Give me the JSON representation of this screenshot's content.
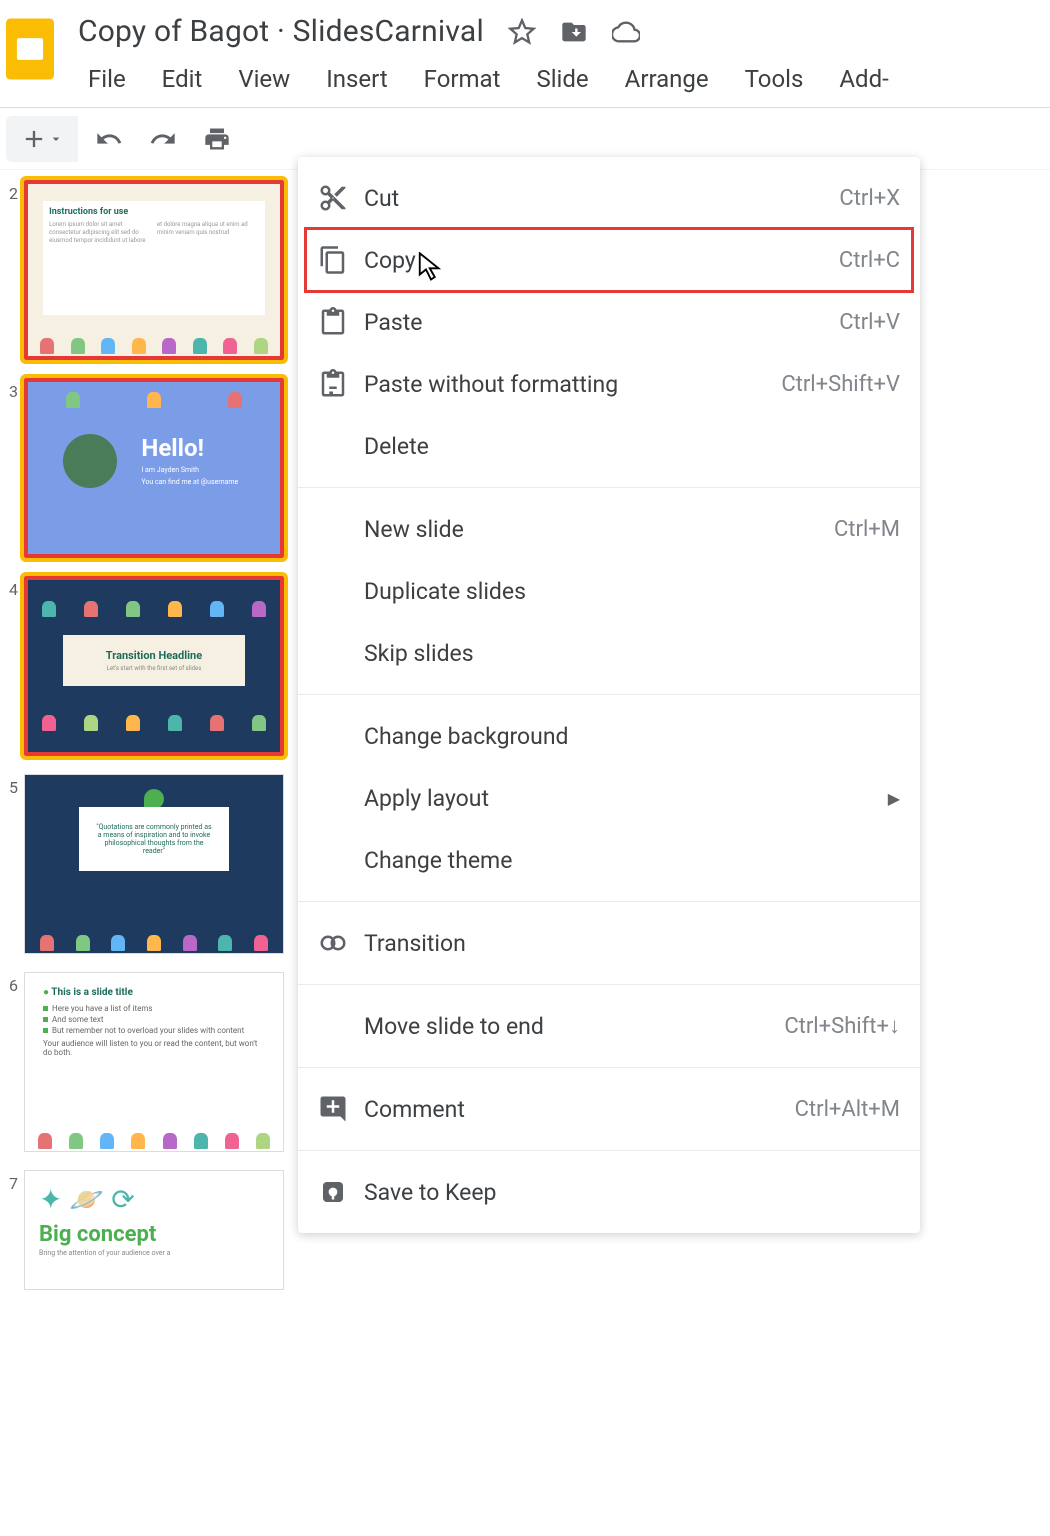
{
  "header": {
    "title": "Copy of Bagot · SlidesCarnival",
    "menus": [
      "File",
      "Edit",
      "View",
      "Insert",
      "Format",
      "Slide",
      "Arrange",
      "Tools",
      "Add-"
    ]
  },
  "thumbnails": [
    {
      "num": "2",
      "title": "Instructions for use",
      "variant": "cream",
      "selected": true,
      "highlighted": true
    },
    {
      "num": "3",
      "title": "Hello!",
      "subtitle": "I am Jayden Smith",
      "line2": "You can find me at @username",
      "variant": "blue",
      "selected": true,
      "highlighted": true
    },
    {
      "num": "4",
      "title": "Transition Headline",
      "subtitle": "Let's start with the first set of slides",
      "variant": "navy",
      "selected": true,
      "highlighted": true
    },
    {
      "num": "5",
      "quote": "\"Quotations are commonly printed as a means of inspiration and to invoke philosophical thoughts from the reader\"",
      "variant": "navy",
      "selected": false,
      "highlighted": false
    },
    {
      "num": "6",
      "title": "This is a slide title",
      "bullets": [
        "Here you have a list of items",
        "And some text",
        "But remember not to overload your slides with content"
      ],
      "footer": "Your audience will listen to you or read the content, but won't do both.",
      "variant": "white",
      "selected": false,
      "highlighted": false
    },
    {
      "num": "7",
      "title": "Big concept",
      "subtitle": "Bring the attention of your audience over a",
      "variant": "white",
      "selected": false,
      "highlighted": false
    }
  ],
  "context_menu": {
    "items": [
      {
        "label": "Cut",
        "shortcut": "Ctrl+X",
        "icon": "cut"
      },
      {
        "label": "Copy",
        "shortcut": "Ctrl+C",
        "icon": "copy",
        "highlighted": true
      },
      {
        "label": "Paste",
        "shortcut": "Ctrl+V",
        "icon": "paste"
      },
      {
        "label": "Paste without formatting",
        "shortcut": "Ctrl+Shift+V",
        "icon": "paste-plain"
      },
      {
        "label": "Delete",
        "shortcut": "",
        "icon": ""
      },
      {
        "sep": true
      },
      {
        "label": "New slide",
        "shortcut": "Ctrl+M",
        "icon": ""
      },
      {
        "label": "Duplicate slides",
        "shortcut": "",
        "icon": ""
      },
      {
        "label": "Skip slides",
        "shortcut": "",
        "icon": ""
      },
      {
        "sep": true
      },
      {
        "label": "Change background",
        "shortcut": "",
        "icon": ""
      },
      {
        "label": "Apply layout",
        "shortcut": "",
        "icon": "",
        "arrow": true
      },
      {
        "label": "Change theme",
        "shortcut": "",
        "icon": ""
      },
      {
        "sep": true
      },
      {
        "label": "Transition",
        "shortcut": "",
        "icon": "transition"
      },
      {
        "sep": true
      },
      {
        "label": "Move slide to end",
        "shortcut": "Ctrl+Shift+↓",
        "icon": ""
      },
      {
        "sep": true
      },
      {
        "label": "Comment",
        "shortcut": "Ctrl+Alt+M",
        "icon": "comment"
      },
      {
        "sep": true
      },
      {
        "label": "Save to Keep",
        "shortcut": "",
        "icon": "keep"
      }
    ]
  }
}
